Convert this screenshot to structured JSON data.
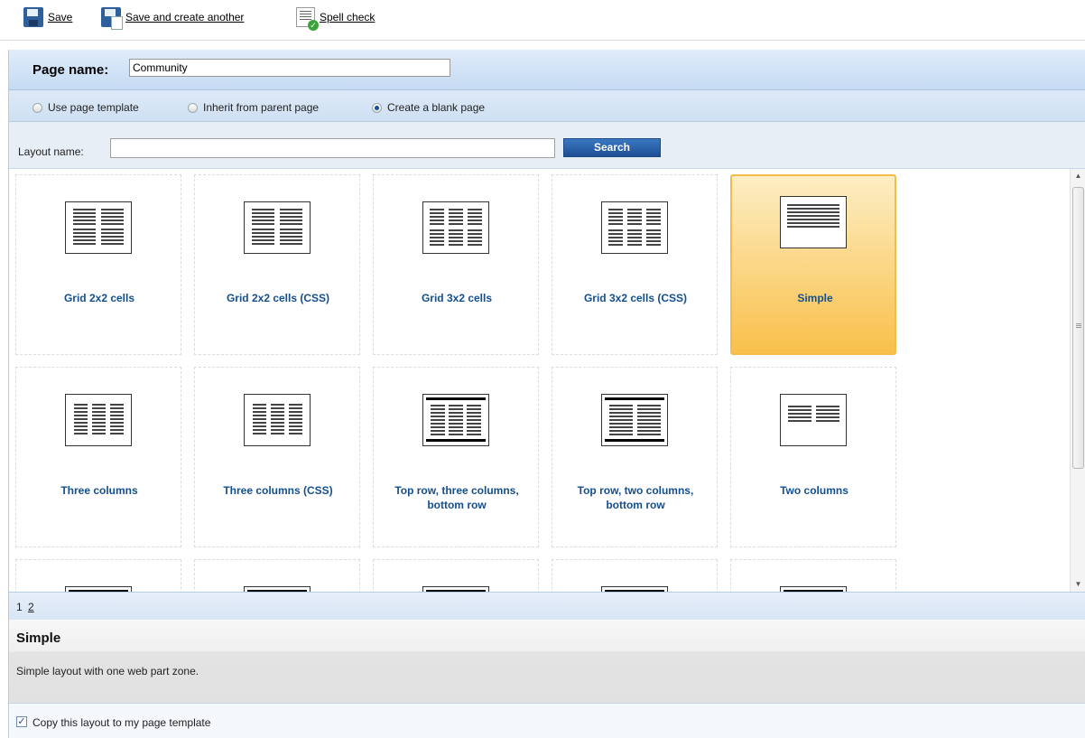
{
  "toolbar": {
    "save": "Save",
    "save_create_another": "Save and create another",
    "spell_check": "Spell check"
  },
  "page_name": {
    "label": "Page name:",
    "value": "Community"
  },
  "source_options": [
    {
      "label": "Use page template",
      "checked": false
    },
    {
      "label": "Inherit from parent page",
      "checked": false
    },
    {
      "label": "Create a blank page",
      "checked": true
    }
  ],
  "search": {
    "label": "Layout name:",
    "value": "",
    "button": "Search"
  },
  "layouts": [
    {
      "name": "Grid 2x2 cells",
      "icon": "grid-2x2-layout-icon",
      "selected": false
    },
    {
      "name": "Grid 2x2 cells (CSS)",
      "icon": "grid-2x2-layout-icon",
      "selected": false
    },
    {
      "name": "Grid 3x2 cells",
      "icon": "grid-3x2-layout-icon",
      "selected": false
    },
    {
      "name": "Grid 3x2 cells (CSS)",
      "icon": "grid-3x2-layout-icon",
      "selected": false
    },
    {
      "name": "Simple",
      "icon": "simple-layout-icon",
      "selected": true
    },
    {
      "name": "Three columns",
      "icon": "three-columns-layout-icon",
      "selected": false
    },
    {
      "name": "Three columns (CSS)",
      "icon": "three-columns-layout-icon",
      "selected": false
    },
    {
      "name": "Top row, three columns, bottom row",
      "icon": "top-three-bottom-layout-icon",
      "selected": false
    },
    {
      "name": "Top row, two columns, bottom row",
      "icon": "top-two-bottom-layout-icon",
      "selected": false
    },
    {
      "name": "Two columns",
      "icon": "two-columns-layout-icon",
      "selected": false
    }
  ],
  "pager": {
    "current": "1",
    "next": "2"
  },
  "selected_layout": {
    "title": "Simple",
    "description": "Simple layout with one web part zone."
  },
  "copy_layout": {
    "label": "Copy this layout to my page template",
    "checked": true
  }
}
